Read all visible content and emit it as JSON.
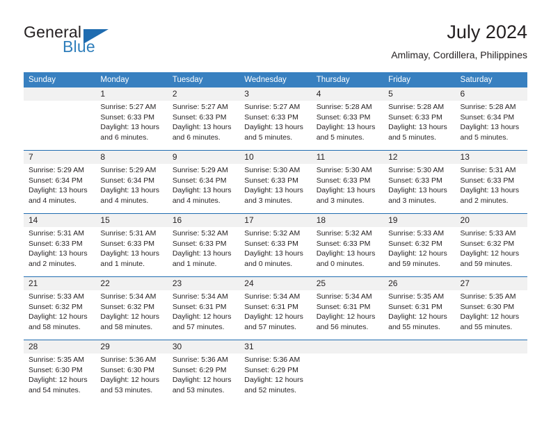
{
  "brand": {
    "name_primary": "General",
    "name_secondary": "Blue",
    "accent_color": "#2e7ebb",
    "flag_color": "#1f6cb0"
  },
  "header": {
    "title": "July 2024",
    "subtitle": "Amlimay, Cordillera, Philippines"
  },
  "calendar": {
    "header_bg": "#3880c0",
    "daynum_bg": "#f1f1f1",
    "rule_color": "#1f6cb0",
    "weekdays": [
      "Sunday",
      "Monday",
      "Tuesday",
      "Wednesday",
      "Thursday",
      "Friday",
      "Saturday"
    ],
    "weeks": [
      [
        {
          "day": "",
          "sunrise": "",
          "sunset": "",
          "daylight_1": "",
          "daylight_2": ""
        },
        {
          "day": "1",
          "sunrise": "Sunrise: 5:27 AM",
          "sunset": "Sunset: 6:33 PM",
          "daylight_1": "Daylight: 13 hours",
          "daylight_2": "and 6 minutes."
        },
        {
          "day": "2",
          "sunrise": "Sunrise: 5:27 AM",
          "sunset": "Sunset: 6:33 PM",
          "daylight_1": "Daylight: 13 hours",
          "daylight_2": "and 6 minutes."
        },
        {
          "day": "3",
          "sunrise": "Sunrise: 5:27 AM",
          "sunset": "Sunset: 6:33 PM",
          "daylight_1": "Daylight: 13 hours",
          "daylight_2": "and 5 minutes."
        },
        {
          "day": "4",
          "sunrise": "Sunrise: 5:28 AM",
          "sunset": "Sunset: 6:33 PM",
          "daylight_1": "Daylight: 13 hours",
          "daylight_2": "and 5 minutes."
        },
        {
          "day": "5",
          "sunrise": "Sunrise: 5:28 AM",
          "sunset": "Sunset: 6:33 PM",
          "daylight_1": "Daylight: 13 hours",
          "daylight_2": "and 5 minutes."
        },
        {
          "day": "6",
          "sunrise": "Sunrise: 5:28 AM",
          "sunset": "Sunset: 6:34 PM",
          "daylight_1": "Daylight: 13 hours",
          "daylight_2": "and 5 minutes."
        }
      ],
      [
        {
          "day": "7",
          "sunrise": "Sunrise: 5:29 AM",
          "sunset": "Sunset: 6:34 PM",
          "daylight_1": "Daylight: 13 hours",
          "daylight_2": "and 4 minutes."
        },
        {
          "day": "8",
          "sunrise": "Sunrise: 5:29 AM",
          "sunset": "Sunset: 6:34 PM",
          "daylight_1": "Daylight: 13 hours",
          "daylight_2": "and 4 minutes."
        },
        {
          "day": "9",
          "sunrise": "Sunrise: 5:29 AM",
          "sunset": "Sunset: 6:34 PM",
          "daylight_1": "Daylight: 13 hours",
          "daylight_2": "and 4 minutes."
        },
        {
          "day": "10",
          "sunrise": "Sunrise: 5:30 AM",
          "sunset": "Sunset: 6:33 PM",
          "daylight_1": "Daylight: 13 hours",
          "daylight_2": "and 3 minutes."
        },
        {
          "day": "11",
          "sunrise": "Sunrise: 5:30 AM",
          "sunset": "Sunset: 6:33 PM",
          "daylight_1": "Daylight: 13 hours",
          "daylight_2": "and 3 minutes."
        },
        {
          "day": "12",
          "sunrise": "Sunrise: 5:30 AM",
          "sunset": "Sunset: 6:33 PM",
          "daylight_1": "Daylight: 13 hours",
          "daylight_2": "and 3 minutes."
        },
        {
          "day": "13",
          "sunrise": "Sunrise: 5:31 AM",
          "sunset": "Sunset: 6:33 PM",
          "daylight_1": "Daylight: 13 hours",
          "daylight_2": "and 2 minutes."
        }
      ],
      [
        {
          "day": "14",
          "sunrise": "Sunrise: 5:31 AM",
          "sunset": "Sunset: 6:33 PM",
          "daylight_1": "Daylight: 13 hours",
          "daylight_2": "and 2 minutes."
        },
        {
          "day": "15",
          "sunrise": "Sunrise: 5:31 AM",
          "sunset": "Sunset: 6:33 PM",
          "daylight_1": "Daylight: 13 hours",
          "daylight_2": "and 1 minute."
        },
        {
          "day": "16",
          "sunrise": "Sunrise: 5:32 AM",
          "sunset": "Sunset: 6:33 PM",
          "daylight_1": "Daylight: 13 hours",
          "daylight_2": "and 1 minute."
        },
        {
          "day": "17",
          "sunrise": "Sunrise: 5:32 AM",
          "sunset": "Sunset: 6:33 PM",
          "daylight_1": "Daylight: 13 hours",
          "daylight_2": "and 0 minutes."
        },
        {
          "day": "18",
          "sunrise": "Sunrise: 5:32 AM",
          "sunset": "Sunset: 6:33 PM",
          "daylight_1": "Daylight: 13 hours",
          "daylight_2": "and 0 minutes."
        },
        {
          "day": "19",
          "sunrise": "Sunrise: 5:33 AM",
          "sunset": "Sunset: 6:32 PM",
          "daylight_1": "Daylight: 12 hours",
          "daylight_2": "and 59 minutes."
        },
        {
          "day": "20",
          "sunrise": "Sunrise: 5:33 AM",
          "sunset": "Sunset: 6:32 PM",
          "daylight_1": "Daylight: 12 hours",
          "daylight_2": "and 59 minutes."
        }
      ],
      [
        {
          "day": "21",
          "sunrise": "Sunrise: 5:33 AM",
          "sunset": "Sunset: 6:32 PM",
          "daylight_1": "Daylight: 12 hours",
          "daylight_2": "and 58 minutes."
        },
        {
          "day": "22",
          "sunrise": "Sunrise: 5:34 AM",
          "sunset": "Sunset: 6:32 PM",
          "daylight_1": "Daylight: 12 hours",
          "daylight_2": "and 58 minutes."
        },
        {
          "day": "23",
          "sunrise": "Sunrise: 5:34 AM",
          "sunset": "Sunset: 6:31 PM",
          "daylight_1": "Daylight: 12 hours",
          "daylight_2": "and 57 minutes."
        },
        {
          "day": "24",
          "sunrise": "Sunrise: 5:34 AM",
          "sunset": "Sunset: 6:31 PM",
          "daylight_1": "Daylight: 12 hours",
          "daylight_2": "and 57 minutes."
        },
        {
          "day": "25",
          "sunrise": "Sunrise: 5:34 AM",
          "sunset": "Sunset: 6:31 PM",
          "daylight_1": "Daylight: 12 hours",
          "daylight_2": "and 56 minutes."
        },
        {
          "day": "26",
          "sunrise": "Sunrise: 5:35 AM",
          "sunset": "Sunset: 6:31 PM",
          "daylight_1": "Daylight: 12 hours",
          "daylight_2": "and 55 minutes."
        },
        {
          "day": "27",
          "sunrise": "Sunrise: 5:35 AM",
          "sunset": "Sunset: 6:30 PM",
          "daylight_1": "Daylight: 12 hours",
          "daylight_2": "and 55 minutes."
        }
      ],
      [
        {
          "day": "28",
          "sunrise": "Sunrise: 5:35 AM",
          "sunset": "Sunset: 6:30 PM",
          "daylight_1": "Daylight: 12 hours",
          "daylight_2": "and 54 minutes."
        },
        {
          "day": "29",
          "sunrise": "Sunrise: 5:36 AM",
          "sunset": "Sunset: 6:30 PM",
          "daylight_1": "Daylight: 12 hours",
          "daylight_2": "and 53 minutes."
        },
        {
          "day": "30",
          "sunrise": "Sunrise: 5:36 AM",
          "sunset": "Sunset: 6:29 PM",
          "daylight_1": "Daylight: 12 hours",
          "daylight_2": "and 53 minutes."
        },
        {
          "day": "31",
          "sunrise": "Sunrise: 5:36 AM",
          "sunset": "Sunset: 6:29 PM",
          "daylight_1": "Daylight: 12 hours",
          "daylight_2": "and 52 minutes."
        },
        {
          "day": "",
          "sunrise": "",
          "sunset": "",
          "daylight_1": "",
          "daylight_2": ""
        },
        {
          "day": "",
          "sunrise": "",
          "sunset": "",
          "daylight_1": "",
          "daylight_2": ""
        },
        {
          "day": "",
          "sunrise": "",
          "sunset": "",
          "daylight_1": "",
          "daylight_2": ""
        }
      ]
    ]
  }
}
